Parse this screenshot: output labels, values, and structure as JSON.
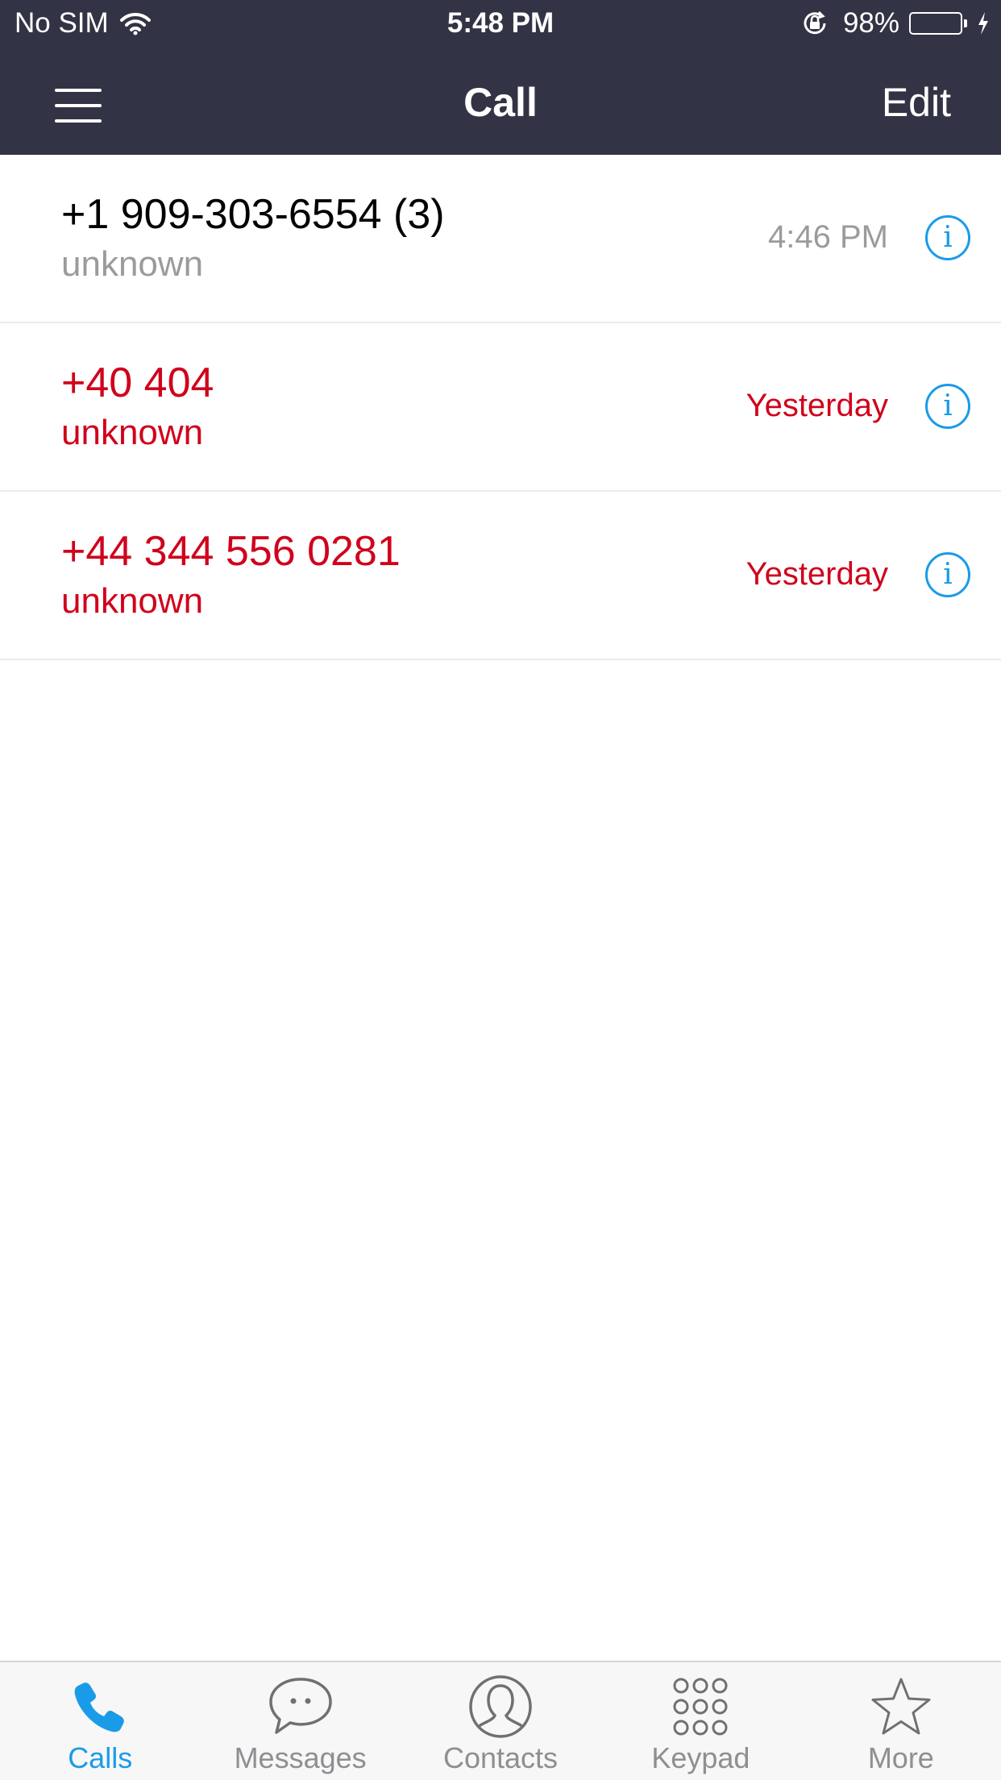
{
  "status_bar": {
    "carrier": "No SIM",
    "time": "5:48 PM",
    "battery": "98%",
    "battery_level": 0.98,
    "battery_color": "#4cd964"
  },
  "nav": {
    "title": "Call",
    "edit_label": "Edit",
    "menu_icon": "hamburger-icon",
    "background": "#323445"
  },
  "calls": [
    {
      "number": "+1 909-303-6554 (3)",
      "label": "unknown",
      "time": "4:46 PM",
      "missed": false
    },
    {
      "number": "+40 404",
      "label": "unknown",
      "time": "Yesterday",
      "missed": true
    },
    {
      "number": "+44 344 556 0281",
      "label": "unknown",
      "time": "Yesterday",
      "missed": true
    }
  ],
  "info_icon": "i",
  "colors": {
    "accent": "#1a9be8",
    "missed": "#d0021b",
    "secondary_text": "#9b9b9b"
  },
  "tabs": [
    {
      "label": "Calls",
      "icon": "phone-icon",
      "active": true
    },
    {
      "label": "Messages",
      "icon": "chat-bubble-icon",
      "active": false
    },
    {
      "label": "Contacts",
      "icon": "person-icon",
      "active": false
    },
    {
      "label": "Keypad",
      "icon": "keypad-icon",
      "active": false
    },
    {
      "label": "More",
      "icon": "star-icon",
      "active": false
    }
  ]
}
